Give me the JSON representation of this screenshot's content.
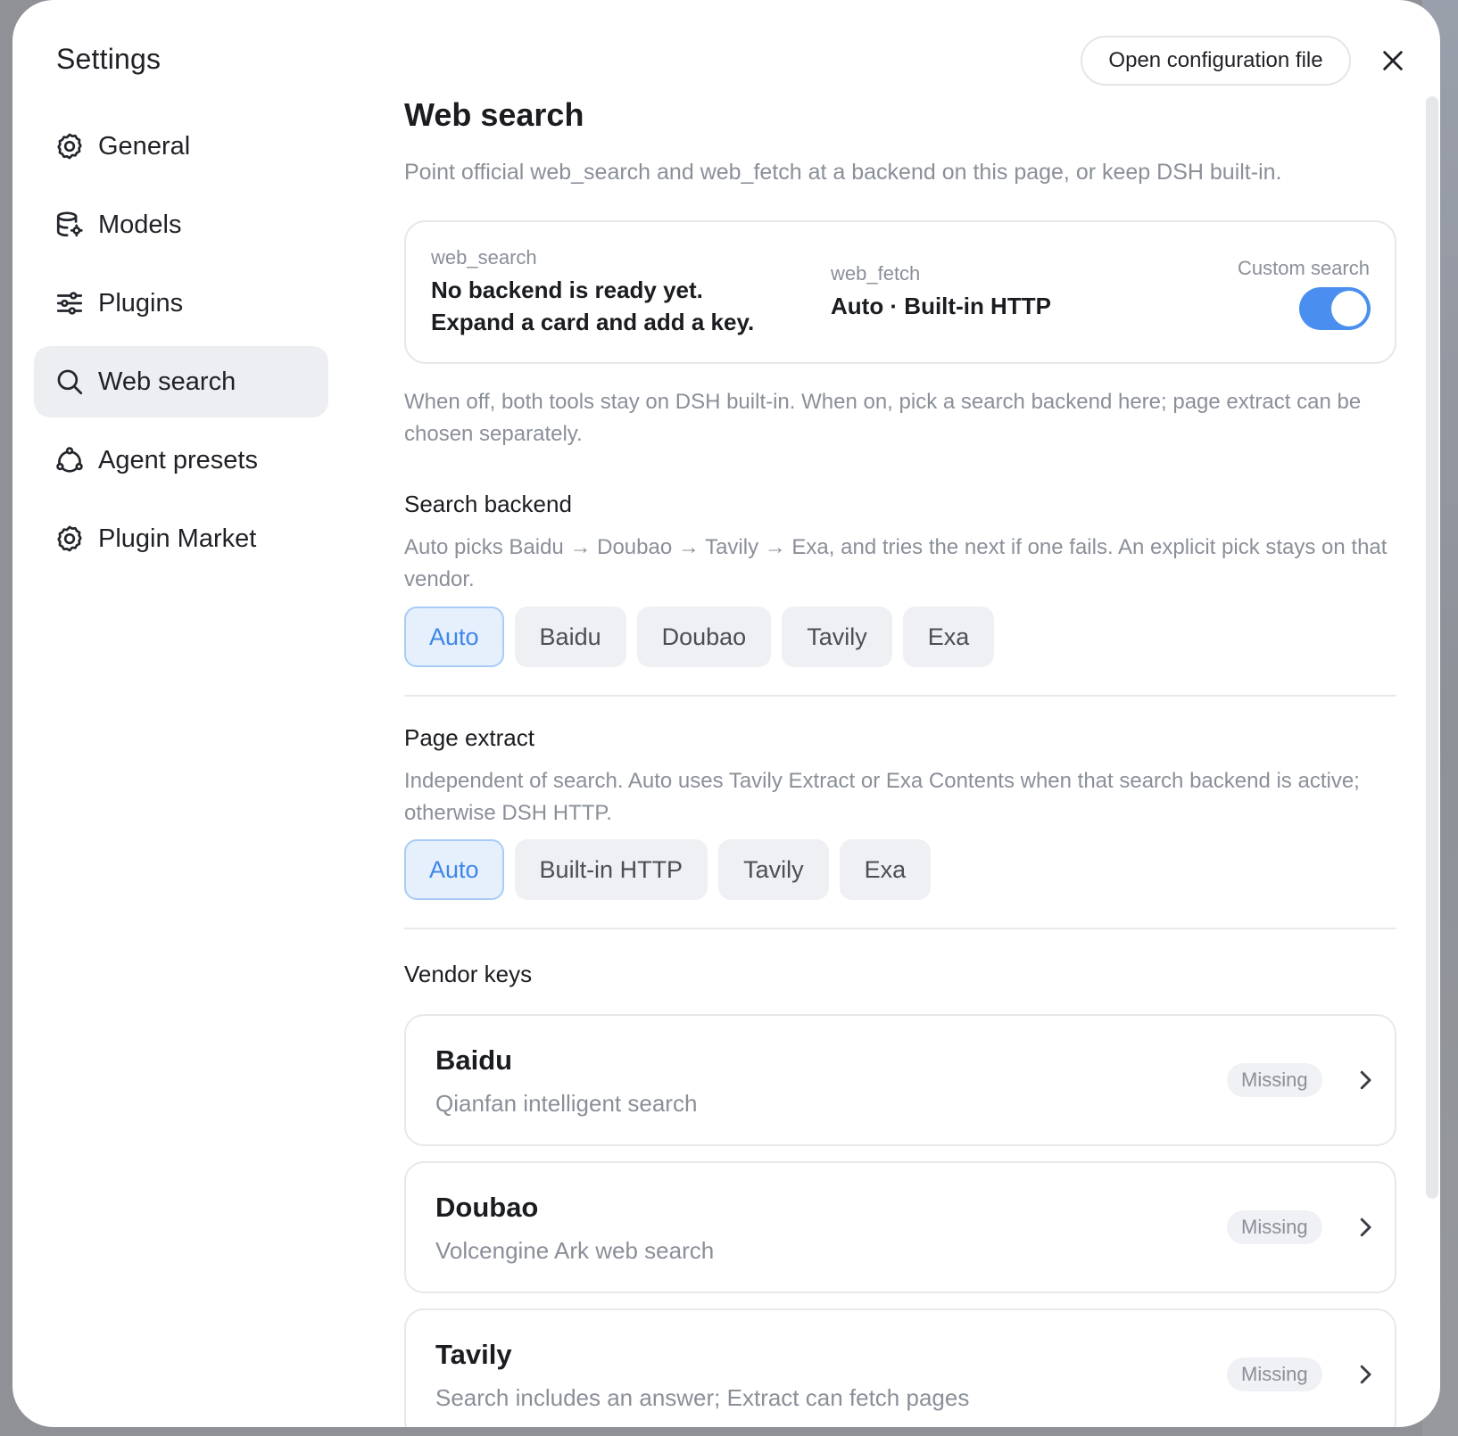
{
  "sidebar": {
    "title": "Settings",
    "items": [
      {
        "label": "General",
        "icon": "gear-icon",
        "active": false
      },
      {
        "label": "Models",
        "icon": "database-gear-icon",
        "active": false
      },
      {
        "label": "Plugins",
        "icon": "sliders-icon",
        "active": false
      },
      {
        "label": "Web search",
        "icon": "search-icon",
        "active": true
      },
      {
        "label": "Agent presets",
        "icon": "agent-network-icon",
        "active": false
      },
      {
        "label": "Plugin Market",
        "icon": "gear-icon",
        "active": false
      }
    ]
  },
  "header": {
    "open_config_label": "Open configuration file",
    "close_icon": "close-icon"
  },
  "main": {
    "title": "Web search",
    "subtitle": "Point official web_search and web_fetch at a backend on this page, or keep DSH built-in.",
    "status": {
      "web_search_label": "web_search",
      "web_search_value_line1": "No backend is ready yet.",
      "web_search_value_line2": "Expand a card and add a key.",
      "web_fetch_label": "web_fetch",
      "web_fetch_value": "Auto · Built-in HTTP",
      "custom_search_label": "Custom search",
      "custom_search_on": true
    },
    "toggle_note": "When off, both tools stay on DSH built-in. When on, pick a search backend here; page extract can be chosen separately.",
    "search_backend": {
      "title": "Search backend",
      "description": "Auto picks Baidu → Doubao → Tavily → Exa, and tries the next if one fails. An explicit pick stays on that vendor.",
      "options": [
        "Auto",
        "Baidu",
        "Doubao",
        "Tavily",
        "Exa"
      ],
      "selected": "Auto"
    },
    "page_extract": {
      "title": "Page extract",
      "description": "Independent of search. Auto uses Tavily Extract or Exa Contents when that search backend is active; otherwise DSH HTTP.",
      "options": [
        "Auto",
        "Built-in HTTP",
        "Tavily",
        "Exa"
      ],
      "selected": "Auto"
    },
    "vendor_keys": {
      "title": "Vendor keys",
      "vendors": [
        {
          "name": "Baidu",
          "description": "Qianfan intelligent search",
          "status": "Missing"
        },
        {
          "name": "Doubao",
          "description": "Volcengine Ark web search",
          "status": "Missing"
        },
        {
          "name": "Tavily",
          "description": "Search includes an answer; Extract can fetch pages",
          "status": "Missing"
        }
      ]
    }
  },
  "colors": {
    "accent": "#4a8ff0",
    "selected_chip_bg": "#e6f0fd",
    "selected_chip_text": "#3e86e8",
    "muted_text": "#8a8f98"
  }
}
